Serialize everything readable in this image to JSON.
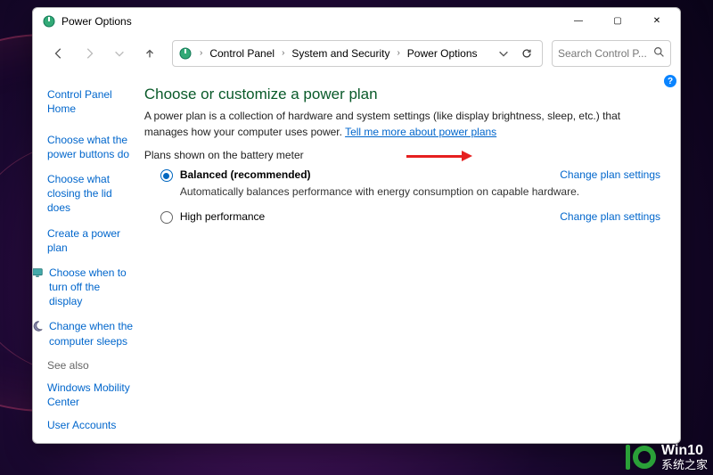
{
  "window": {
    "title": "Power Options"
  },
  "winctl": {
    "min": "—",
    "max": "▢",
    "close": "✕"
  },
  "breadcrumb": {
    "a": "Control Panel",
    "b": "System and Security",
    "c": "Power Options"
  },
  "search": {
    "placeholder": "Search Control P..."
  },
  "sidebar": {
    "home": "Control Panel Home",
    "links": [
      "Choose what the power buttons do",
      "Choose what closing the lid does",
      "Create a power plan",
      "Choose when to turn off the display",
      "Change when the computer sleeps"
    ],
    "seealso": "See also",
    "seealso_links": [
      "Windows Mobility Center",
      "User Accounts"
    ]
  },
  "main": {
    "heading": "Choose or customize a power plan",
    "desc_a": "A power plan is a collection of hardware and system settings (like display brightness, sleep, etc.) that manages how your computer uses power. ",
    "desc_link": "Tell me more about power plans",
    "section_label": "Plans shown on the battery meter",
    "plans": [
      {
        "label": "Balanced (recommended)",
        "desc": "Automatically balances performance with energy consumption on capable hardware.",
        "checked": true,
        "change": "Change plan settings"
      },
      {
        "label": "High performance",
        "desc": "",
        "checked": false,
        "change": "Change plan settings"
      }
    ]
  },
  "help": {
    "q": "?"
  },
  "watermark": {
    "l1": "Win10",
    "l2": "系统之家"
  }
}
